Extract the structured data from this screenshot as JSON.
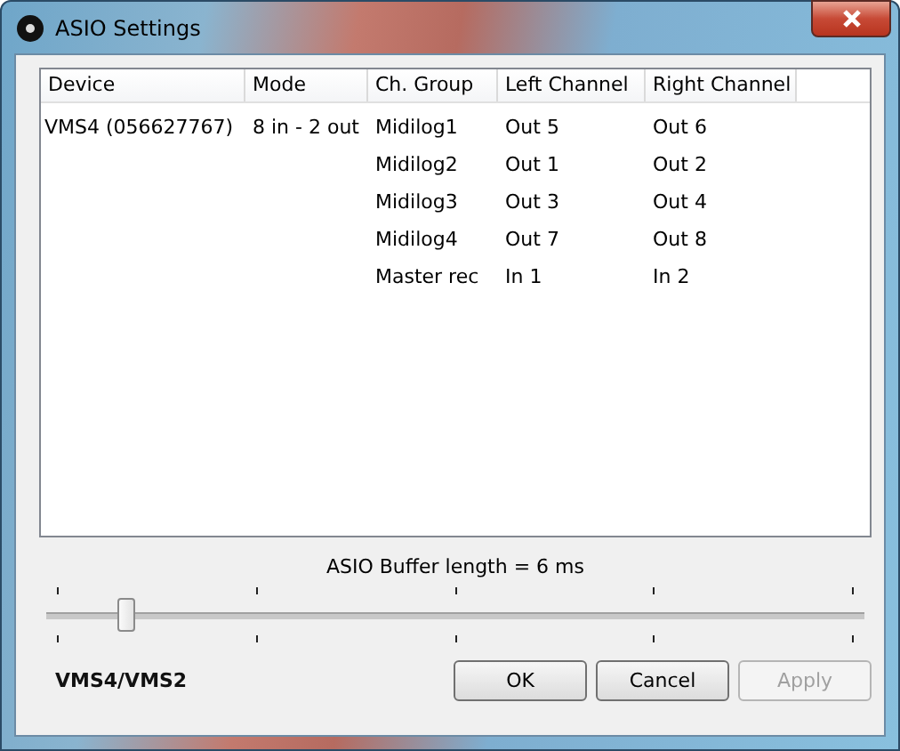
{
  "window": {
    "title": "ASIO Settings"
  },
  "table": {
    "columns": [
      "Device",
      "Mode",
      "Ch. Group",
      "Left Channel",
      "Right Channel"
    ],
    "rows": [
      {
        "device": "VMS4 (056627767)",
        "mode": "8 in - 2 out",
        "ch_group": "Midilog1",
        "left": "Out 5",
        "right": "Out 6"
      },
      {
        "ch_group": "Midilog2",
        "left": "Out 1",
        "right": "Out 2"
      },
      {
        "ch_group": "Midilog3",
        "left": "Out 3",
        "right": "Out 4"
      },
      {
        "ch_group": "Midilog4",
        "left": "Out 7",
        "right": "Out 8"
      },
      {
        "ch_group": "Master rec",
        "left": "In 1",
        "right": "In 2"
      }
    ]
  },
  "buffer": {
    "label": "ASIO Buffer length = 6 ms",
    "level": 0.1
  },
  "brand": "VMS4/VMS2",
  "buttons": [
    {
      "label": "OK",
      "disabled": false
    },
    {
      "label": "Cancel",
      "disabled": false
    },
    {
      "label": "Apply",
      "disabled": true
    }
  ]
}
